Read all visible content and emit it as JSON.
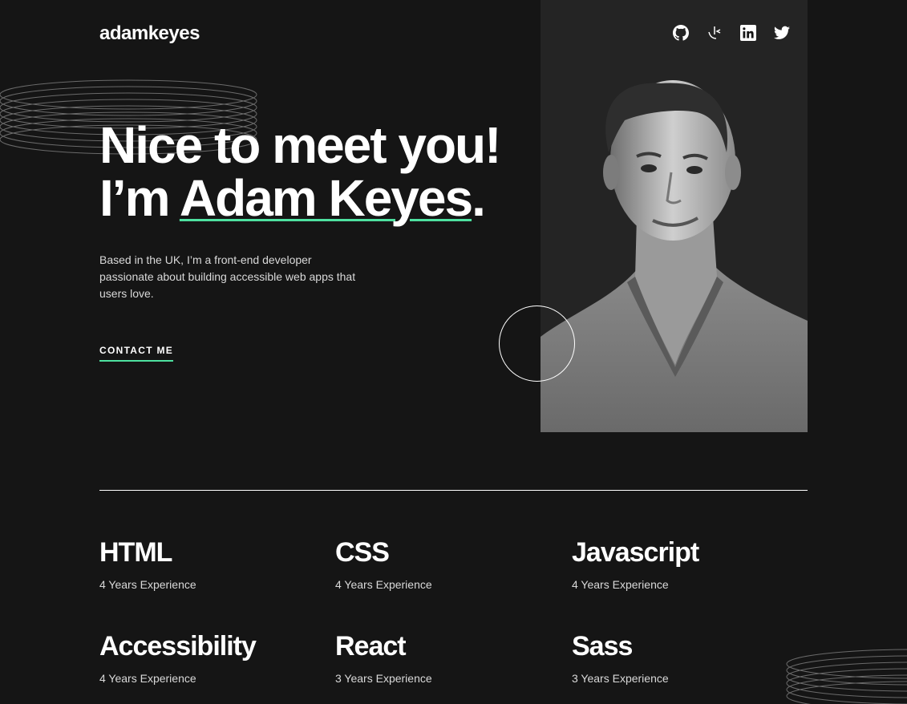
{
  "header": {
    "logo": "adamkeyes",
    "socials": [
      {
        "name": "github",
        "icon": "github-icon"
      },
      {
        "name": "frontend-mentor",
        "icon": "frontend-mentor-icon"
      },
      {
        "name": "linkedin",
        "icon": "linkedin-icon"
      },
      {
        "name": "twitter",
        "icon": "twitter-icon"
      }
    ]
  },
  "hero": {
    "title_line1": "Nice to meet you!",
    "title_line2_prefix": "I’m ",
    "title_name": "Adam Keyes",
    "title_suffix": ".",
    "intro": "Based in the UK, I’m a front-end developer passionate about building accessible web apps that users love.",
    "contact_label": "CONTACT ME",
    "accent_color": "#4ee1a0"
  },
  "skills": [
    {
      "name": "HTML",
      "experience": "4 Years Experience"
    },
    {
      "name": "CSS",
      "experience": "4 Years Experience"
    },
    {
      "name": "Javascript",
      "experience": "4 Years Experience"
    },
    {
      "name": "Accessibility",
      "experience": "4 Years Experience"
    },
    {
      "name": "React",
      "experience": "3 Years Experience"
    },
    {
      "name": "Sass",
      "experience": "3 Years Experience"
    }
  ],
  "colors": {
    "background": "#151515",
    "panel": "#242424",
    "text": "#ffffff",
    "muted": "#d9d9d9",
    "accent": "#4ee1a0"
  }
}
